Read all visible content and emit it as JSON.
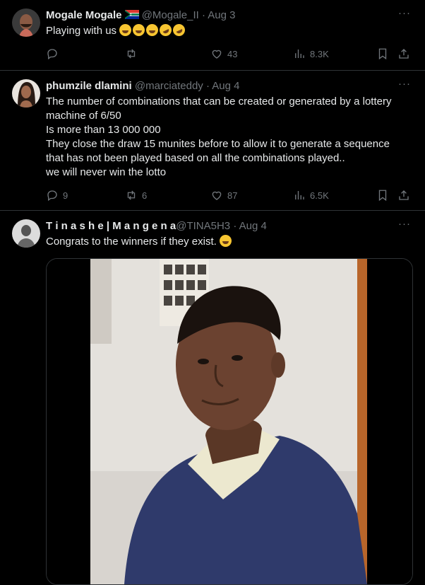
{
  "tweets": [
    {
      "name": "Mogale Mogale",
      "handle": "@Mogale_II",
      "date": "· Aug 3",
      "text": [
        "Playing with us"
      ],
      "stats": {
        "replies": "",
        "reposts": "",
        "likes": "43",
        "views": "8.3K"
      }
    },
    {
      "name": "phumzile dlamini",
      "handle": "@marciateddy",
      "date": "· Aug 4",
      "text": [
        "The number of combinations that can be created  or generated by a lottery",
        "machine of 6/50",
        "Is more than 13 000 000",
        "They close the draw 15 munites before to allow it to generate a sequence",
        "that has not been played based on all the combinations played..",
        "we will never win the lotto"
      ],
      "stats": {
        "replies": "9",
        "reposts": "6",
        "likes": "87",
        "views": "6.5K"
      }
    },
    {
      "name": "T i n a s h e | M a n g e n a",
      "handle": "@TINA5H3",
      "date": "· Aug 4",
      "text": [
        "Congrats to the winners if they exist."
      ]
    }
  ],
  "icons": {
    "reply": "reply-icon",
    "repost": "repost-icon",
    "like": "heart-icon",
    "views": "views-icon",
    "bookmark": "bookmark-icon",
    "share": "share-icon",
    "more": "more-icon"
  },
  "colors": {
    "background": "#000000",
    "text": "#e7e9ea",
    "muted": "#71767b",
    "divider": "#2f3336"
  }
}
